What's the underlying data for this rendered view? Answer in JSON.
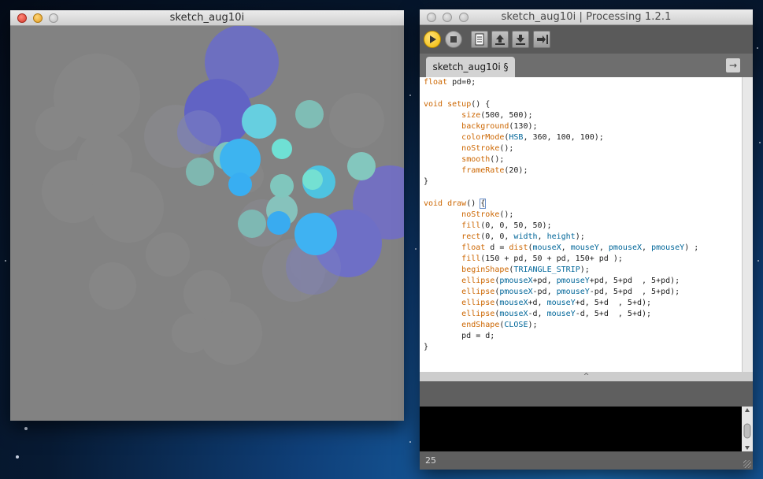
{
  "sketch_window": {
    "title": "sketch_aug10i"
  },
  "ide_window": {
    "title": "sketch_aug10i | Processing 1.2.1",
    "toolbar": {
      "run": "play-icon",
      "stop": "stop-icon",
      "new": "new-file-icon",
      "open": "open-icon",
      "save": "save-icon",
      "export": "export-icon"
    },
    "tab_label": "sketch_aug10i §",
    "tab_menu_icon": "right-arrow-icon",
    "code_lines": [
      "float pd=0;",
      "",
      "void setup() {",
      "        size(500, 500);",
      "        background(130);",
      "        colorMode(HSB, 360, 100, 100);",
      "        noStroke();",
      "        smooth();",
      "        frameRate(20);",
      "}",
      "",
      "void draw() {",
      "        noStroke();",
      "        fill(0, 0, 50, 50);",
      "        rect(0, 0, width, height);",
      "        float d = dist(mouseX, mouseY, pmouseX, pmouseY) ;",
      "        fill(150 + pd, 50 + pd, 150+ pd );",
      "        beginShape(TRIANGLE_STRIP);",
      "        ellipse(pmouseX+pd, pmouseY+pd, 5+pd  , 5+pd);",
      "        ellipse(pmouseX-pd, pmouseY-pd, 5+pd  , 5+pd);",
      "        ellipse(mouseX+d, mouseY+d, 5+d  , 5+d);",
      "        ellipse(mouseX-d, mouseY-d, 5+d  , 5+d);",
      "        endShape(CLOSE);",
      "        pd = d;",
      "}"
    ],
    "divider_glyph": "^",
    "status_line": "25"
  },
  "colors": {
    "sketch_background": "#828282",
    "ide_toolbar": "#5a5a5a",
    "run_button": "#f7c52a",
    "keyword": "#cc6600",
    "constant": "#006699"
  }
}
